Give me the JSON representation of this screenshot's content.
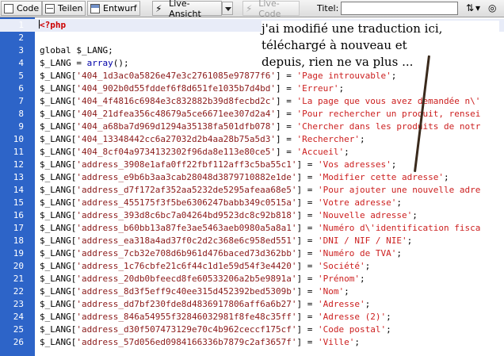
{
  "toolbar": {
    "code_label": "Code",
    "split_label": "Teilen",
    "design_label": "Entwurf",
    "live_view_label": "Live-Ansicht",
    "live_code_label": "Live-Code",
    "title_label": "Titel:",
    "title_value": ""
  },
  "annotation": {
    "line1": "j'ai modifié une traduction ici,",
    "line2": "téléchargé à nouveau et",
    "line3": "depuis, rien ne va plus ..."
  },
  "editor": {
    "lines": [
      {
        "n": "1",
        "parts": [
          {
            "t": "<?php",
            "c": "kw"
          }
        ]
      },
      {
        "n": "2",
        "parts": []
      },
      {
        "n": "3",
        "parts": [
          {
            "t": "global $_LANG;",
            "c": "var"
          }
        ]
      },
      {
        "n": "4",
        "parts": [
          {
            "t": "$_LANG = ",
            "c": "var"
          },
          {
            "t": "array",
            "c": "op"
          },
          {
            "t": "();",
            "c": "var"
          }
        ]
      },
      {
        "n": "5",
        "parts": [
          {
            "t": "$_LANG[",
            "c": "var"
          },
          {
            "t": "'404_1d3ac0a5826e47e3c2761085e97877f6'",
            "c": "key"
          },
          {
            "t": "] = ",
            "c": "var"
          },
          {
            "t": "'Page introuvable'",
            "c": "str"
          },
          {
            "t": ";",
            "c": "var"
          }
        ]
      },
      {
        "n": "6",
        "parts": [
          {
            "t": "$_LANG[",
            "c": "var"
          },
          {
            "t": "'404_902b0d55fddef6f8d651fe1035b7d4bd'",
            "c": "key"
          },
          {
            "t": "] = ",
            "c": "var"
          },
          {
            "t": "'Erreur'",
            "c": "str"
          },
          {
            "t": ";",
            "c": "var"
          }
        ]
      },
      {
        "n": "7",
        "parts": [
          {
            "t": "$_LANG[",
            "c": "var"
          },
          {
            "t": "'404_4f4816c6984e3c832882b39d8fecbd2c'",
            "c": "key"
          },
          {
            "t": "] = ",
            "c": "var"
          },
          {
            "t": "'La page que vous avez demandée n\\'",
            "c": "str"
          }
        ]
      },
      {
        "n": "8",
        "parts": [
          {
            "t": "$_LANG[",
            "c": "var"
          },
          {
            "t": "'404_21dfea356c48679a5ce6671ee307d2a4'",
            "c": "key"
          },
          {
            "t": "] = ",
            "c": "var"
          },
          {
            "t": "'Pour rechercher un produit, rensei",
            "c": "str"
          }
        ]
      },
      {
        "n": "9",
        "parts": [
          {
            "t": "$_LANG[",
            "c": "var"
          },
          {
            "t": "'404_a68ba7d969d1294a35138fa501dfb078'",
            "c": "key"
          },
          {
            "t": "] = ",
            "c": "var"
          },
          {
            "t": "'Chercher dans les produits de notr",
            "c": "str"
          }
        ]
      },
      {
        "n": "10",
        "parts": [
          {
            "t": "$_LANG[",
            "c": "var"
          },
          {
            "t": "'404_13348442cc6a27032d2b4aa28b75a5d3'",
            "c": "key"
          },
          {
            "t": "] = ",
            "c": "var"
          },
          {
            "t": "'Rechercher'",
            "c": "str"
          },
          {
            "t": ";",
            "c": "var"
          }
        ]
      },
      {
        "n": "11",
        "parts": [
          {
            "t": "$_LANG[",
            "c": "var"
          },
          {
            "t": "'404_8cf04a9734132302f96da8e113e80ce5'",
            "c": "key"
          },
          {
            "t": "] = ",
            "c": "var"
          },
          {
            "t": "'Accueil'",
            "c": "str"
          },
          {
            "t": ";",
            "c": "var"
          }
        ]
      },
      {
        "n": "12",
        "parts": [
          {
            "t": "$_LANG[",
            "c": "var"
          },
          {
            "t": "'address_3908e1afa0ff22fbf112aff3c5ba55c1'",
            "c": "key"
          },
          {
            "t": "] = ",
            "c": "var"
          },
          {
            "t": "'Vos adresses'",
            "c": "str"
          },
          {
            "t": ";",
            "c": "var"
          }
        ]
      },
      {
        "n": "13",
        "parts": [
          {
            "t": "$_LANG[",
            "c": "var"
          },
          {
            "t": "'address_e9b6b3aa3cab28048d3879710882e1de'",
            "c": "key"
          },
          {
            "t": "] = ",
            "c": "var"
          },
          {
            "t": "'Modifier cette adresse'",
            "c": "str"
          },
          {
            "t": ";",
            "c": "var"
          }
        ]
      },
      {
        "n": "14",
        "parts": [
          {
            "t": "$_LANG[",
            "c": "var"
          },
          {
            "t": "'address_d7f172af352aa5232de5295afeaa68e5'",
            "c": "key"
          },
          {
            "t": "] = ",
            "c": "var"
          },
          {
            "t": "'Pour ajouter une nouvelle adre",
            "c": "str"
          }
        ]
      },
      {
        "n": "15",
        "parts": [
          {
            "t": "$_LANG[",
            "c": "var"
          },
          {
            "t": "'address_455175f3f5be6306247babb349c0515a'",
            "c": "key"
          },
          {
            "t": "] = ",
            "c": "var"
          },
          {
            "t": "'Votre adresse'",
            "c": "str"
          },
          {
            "t": ";",
            "c": "var"
          }
        ]
      },
      {
        "n": "16",
        "parts": [
          {
            "t": "$_LANG[",
            "c": "var"
          },
          {
            "t": "'address_393d8c6bc7a04264bd9523dc8c92b818'",
            "c": "key"
          },
          {
            "t": "] = ",
            "c": "var"
          },
          {
            "t": "'Nouvelle adresse'",
            "c": "str"
          },
          {
            "t": ";",
            "c": "var"
          }
        ]
      },
      {
        "n": "17",
        "parts": [
          {
            "t": "$_LANG[",
            "c": "var"
          },
          {
            "t": "'address_b60bb13a87fe3ae5463aeb0980a5a8a1'",
            "c": "key"
          },
          {
            "t": "] = ",
            "c": "var"
          },
          {
            "t": "'Numéro d\\'identification fisca",
            "c": "str"
          }
        ]
      },
      {
        "n": "18",
        "parts": [
          {
            "t": "$_LANG[",
            "c": "var"
          },
          {
            "t": "'address_ea318a4ad37f0c2d2c368e6c958ed551'",
            "c": "key"
          },
          {
            "t": "] = ",
            "c": "var"
          },
          {
            "t": "'DNI / NIF / NIE'",
            "c": "str"
          },
          {
            "t": ";",
            "c": "var"
          }
        ]
      },
      {
        "n": "19",
        "parts": [
          {
            "t": "$_LANG[",
            "c": "var"
          },
          {
            "t": "'address_7cb32e708d6b961d476baced73d362bb'",
            "c": "key"
          },
          {
            "t": "] = ",
            "c": "var"
          },
          {
            "t": "'Numéro de TVA'",
            "c": "str"
          },
          {
            "t": ";",
            "c": "var"
          }
        ]
      },
      {
        "n": "20",
        "parts": [
          {
            "t": "$_LANG[",
            "c": "var"
          },
          {
            "t": "'address_1c76cbfe21c6f44c1d1e59d54f3e4420'",
            "c": "key"
          },
          {
            "t": "] = ",
            "c": "var"
          },
          {
            "t": "'Société'",
            "c": "str"
          },
          {
            "t": ";",
            "c": "var"
          }
        ]
      },
      {
        "n": "21",
        "parts": [
          {
            "t": "$_LANG[",
            "c": "var"
          },
          {
            "t": "'address_20db0bfeecd8fe60533206a2b5e9891a'",
            "c": "key"
          },
          {
            "t": "] = ",
            "c": "var"
          },
          {
            "t": "'Prénom'",
            "c": "str"
          },
          {
            "t": ";",
            "c": "var"
          }
        ]
      },
      {
        "n": "22",
        "parts": [
          {
            "t": "$_LANG[",
            "c": "var"
          },
          {
            "t": "'address_8d3f5eff9c40ee315d452392bed5309b'",
            "c": "key"
          },
          {
            "t": "] = ",
            "c": "var"
          },
          {
            "t": "'Nom'",
            "c": "str"
          },
          {
            "t": ";",
            "c": "var"
          }
        ]
      },
      {
        "n": "23",
        "parts": [
          {
            "t": "$_LANG[",
            "c": "var"
          },
          {
            "t": "'address_dd7bf230fde8d4836917806aff6a6b27'",
            "c": "key"
          },
          {
            "t": "] = ",
            "c": "var"
          },
          {
            "t": "'Adresse'",
            "c": "str"
          },
          {
            "t": ";",
            "c": "var"
          }
        ]
      },
      {
        "n": "24",
        "parts": [
          {
            "t": "$_LANG[",
            "c": "var"
          },
          {
            "t": "'address_846a54955f32846032981f8fe48c35ff'",
            "c": "key"
          },
          {
            "t": "] = ",
            "c": "var"
          },
          {
            "t": "'Adresse (2)'",
            "c": "str"
          },
          {
            "t": ";",
            "c": "var"
          }
        ]
      },
      {
        "n": "25",
        "parts": [
          {
            "t": "$_LANG[",
            "c": "var"
          },
          {
            "t": "'address_d30f507473129e70c4b962ceccf175cf'",
            "c": "key"
          },
          {
            "t": "] = ",
            "c": "var"
          },
          {
            "t": "'Code postal'",
            "c": "str"
          },
          {
            "t": ";",
            "c": "var"
          }
        ]
      },
      {
        "n": "26",
        "parts": [
          {
            "t": "$_LANG[",
            "c": "var"
          },
          {
            "t": "'address_57d056ed0984166336b7879c2af3657f'",
            "c": "key"
          },
          {
            "t": "] = ",
            "c": "var"
          },
          {
            "t": "'Ville'",
            "c": "str"
          },
          {
            "t": ";",
            "c": "var"
          }
        ]
      }
    ]
  }
}
